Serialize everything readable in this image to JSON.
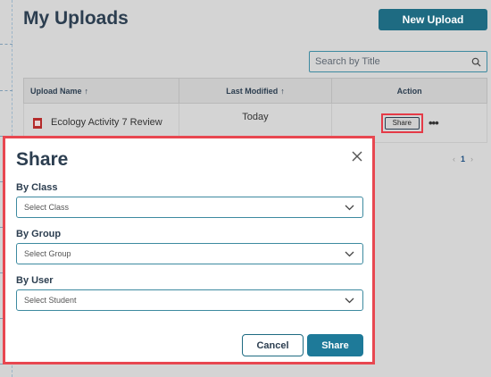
{
  "page": {
    "title": "My Uploads",
    "new_upload_label": "New Upload",
    "search_placeholder": "Search by Title"
  },
  "table": {
    "columns": [
      "Upload Name",
      "Last Modified",
      "Action"
    ],
    "sort_indicator": "↑",
    "rows": [
      {
        "name": "Ecology Activity 7 Review",
        "modified": "Today",
        "action_label": "Share",
        "more_label": "•••"
      }
    ]
  },
  "pagination": {
    "prev": "‹",
    "current": "1",
    "next": "›"
  },
  "modal": {
    "title": "Share",
    "close_label": "×",
    "fields": [
      {
        "label": "By Class",
        "placeholder": "Select Class"
      },
      {
        "label": "By Group",
        "placeholder": "Select Group"
      },
      {
        "label": "By User",
        "placeholder": "Select Student"
      }
    ],
    "cancel_label": "Cancel",
    "share_label": "Share"
  },
  "colors": {
    "accent": "#1e7a99",
    "highlight": "#e84750",
    "overlay": "#d4d4d4"
  },
  "icons": {
    "search": "search-icon",
    "close": "close-icon",
    "chevron": "chevron-down-icon",
    "file": "pdf-file-icon",
    "more": "more-icon"
  }
}
